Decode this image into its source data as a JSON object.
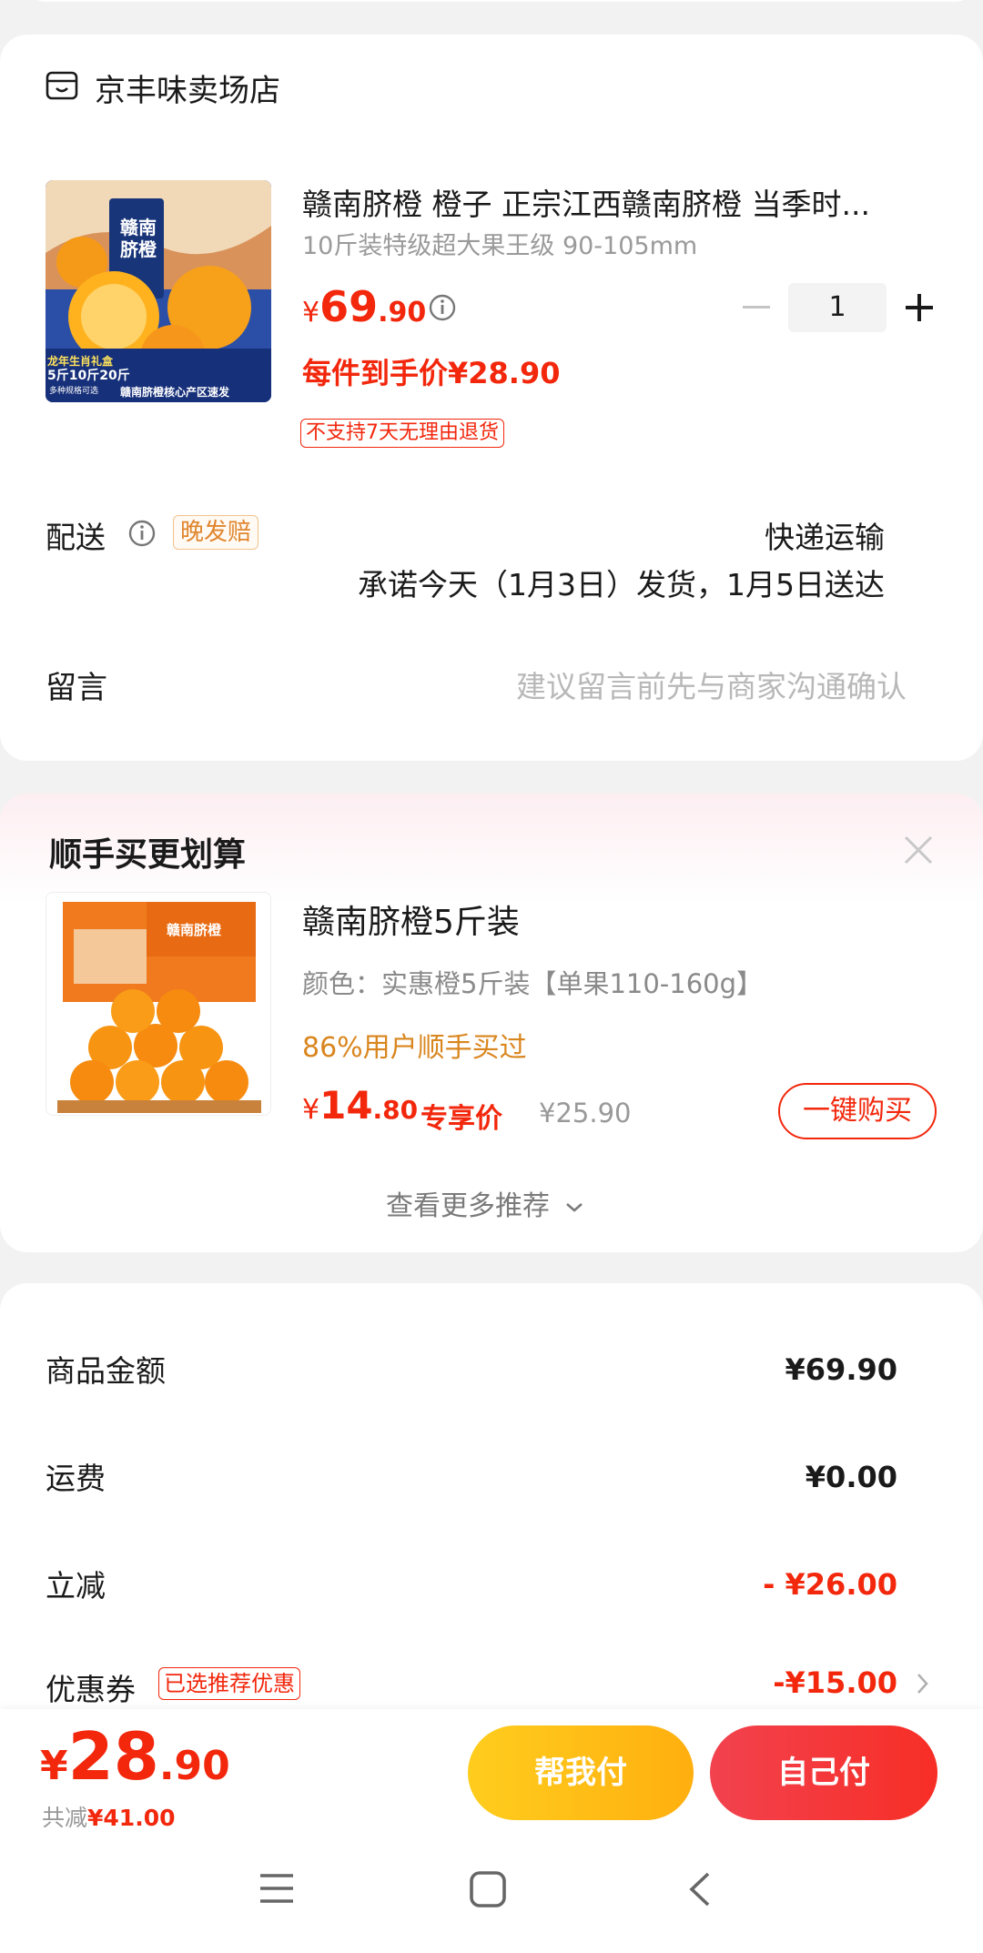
{
  "store": {
    "name": "京丰味卖场店"
  },
  "product": {
    "title": "赣南脐橙 橙子 正宗江西赣南脐橙 当季时...",
    "spec": "10斤装特级超大果王级 90-105mm",
    "price_symbol": "¥",
    "price_int": "69",
    "price_dec": ".90",
    "final_price": "每件到手价¥28.90",
    "return_tag": "不支持7天无理由退货",
    "quantity": "1",
    "image_badge_lines": [
      "龙年生肖礼盒",
      "5斤10斤20斤",
      "多种规格可选",
      "赣南脐橙核心产区速发"
    ],
    "image_brand": "赣南脐橙"
  },
  "delivery": {
    "label": "配送",
    "tag": "晚发赔",
    "method": "快递运输",
    "promise": "承诺今天（1月3日）发货，1月5日送达"
  },
  "message": {
    "label": "留言",
    "placeholder": "建议留言前先与商家沟通确认"
  },
  "recommend": {
    "title": "顺手买更划算",
    "item_title": "赣南脐橙5斤装",
    "item_spec": "颜色：实惠橙5斤装【单果110-160g】",
    "item_social": "86%用户顺手买过",
    "price_symbol": "¥",
    "price_int": "14",
    "price_dec": ".80",
    "price_label": "专享价",
    "orig_price": "¥25.90",
    "buy_label": "一键购买",
    "more_label": "查看更多推荐",
    "image_brand": "赣南脐橙"
  },
  "summary": {
    "rows": [
      {
        "label": "商品金额",
        "value": "¥69.90"
      },
      {
        "label": "运费",
        "value": "¥0.00"
      },
      {
        "label": "立减",
        "value": "- ¥26.00"
      },
      {
        "label": "优惠券",
        "value": "-¥15.00",
        "tag": "已选推荐优惠"
      }
    ]
  },
  "footer": {
    "total_symbol": "¥",
    "total_int": "28",
    "total_dec": ".90",
    "discount_label": "共减",
    "discount_value": "¥41.00",
    "help_pay": "帮我付",
    "self_pay": "自己付"
  },
  "colors": {
    "accent_red": "#f2270c",
    "help_pay": "#ffbf15",
    "self_pay": "#f03a3a",
    "orange_text": "#e0852d"
  }
}
